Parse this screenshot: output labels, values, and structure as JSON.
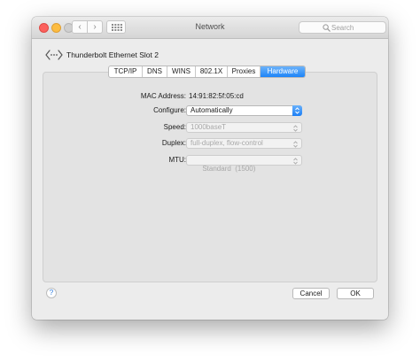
{
  "window": {
    "title": "Network",
    "search_placeholder": "Search"
  },
  "interface": {
    "name": "Thunderbolt Ethernet Slot 2",
    "icon": "ethernet-icon"
  },
  "tabs": [
    {
      "label": "TCP/IP",
      "active": false
    },
    {
      "label": "DNS",
      "active": false
    },
    {
      "label": "WINS",
      "active": false
    },
    {
      "label": "802.1X",
      "active": false
    },
    {
      "label": "Proxies",
      "active": false
    },
    {
      "label": "Hardware",
      "active": true
    }
  ],
  "hardware": {
    "mac_label": "MAC Address:",
    "mac_value": "14:91:82:5f:05:cd",
    "configure_label": "Configure:",
    "configure_value": "Automatically",
    "speed_label": "Speed:",
    "speed_value": "1000baseT",
    "duplex_label": "Duplex:",
    "duplex_value": "full-duplex, flow-control",
    "mtu_label": "MTU:",
    "mtu_value": "Standard  (1500)"
  },
  "buttons": {
    "help": "?",
    "cancel": "Cancel",
    "ok": "OK"
  },
  "colors": {
    "accent": "#1d84f8",
    "close": "#fc605c",
    "minimize": "#fdbc40"
  }
}
